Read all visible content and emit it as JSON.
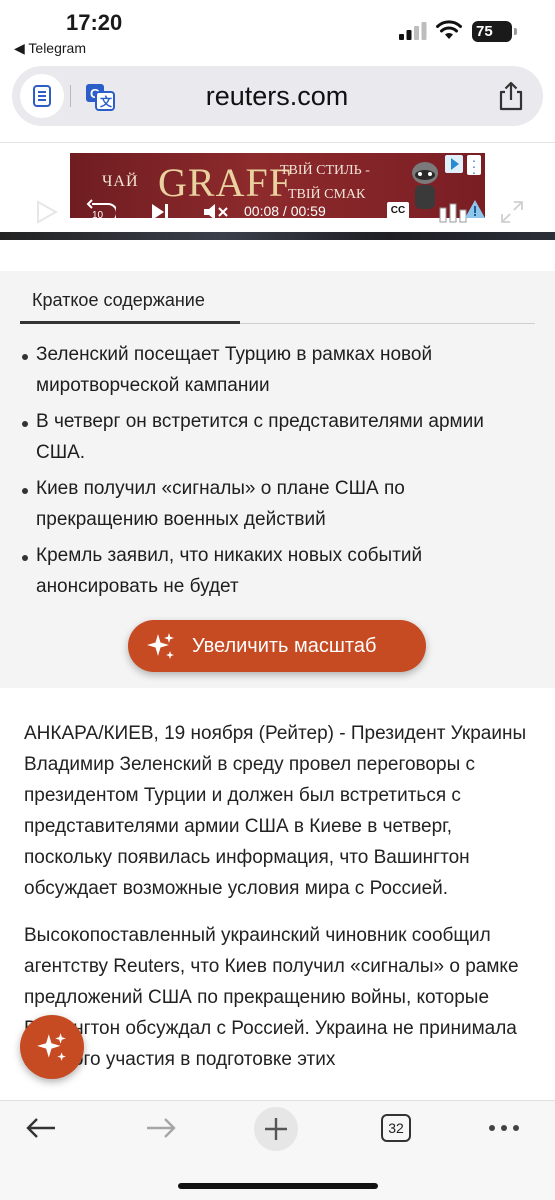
{
  "status": {
    "time": "17:20",
    "back_app": "◀ Telegram",
    "battery": "75"
  },
  "browser": {
    "domain": "reuters.com",
    "reader_icon": "reader-icon",
    "translate_icon": "translate-icon",
    "share_icon": "share-icon"
  },
  "ad": {
    "left_word": "ЧАЙ",
    "brand": "GRAFF",
    "slogan_line1": "ТВІЙ СТИЛЬ -",
    "slogan_line2": "ТВІЙ СМАК",
    "rewind_seconds": "10",
    "video_time": "00:08 / 00:59",
    "cc_label": "CC"
  },
  "summary": {
    "tab_label": "Краткое содержание",
    "bullets": [
      "Зеленский посещает Турцию в рамках новой миротворческой кампании",
      "В четверг он встретится с представителями армии США.",
      "Киев получил «сигналы» о плане США по прекращению военных действий",
      "Кремль заявил, что никаких новых событий анонсировать не будет"
    ],
    "zoom_button": "Увеличить масштаб"
  },
  "article": {
    "paragraphs": [
      "АНКАРА/КИЕВ, 19 ноября (Рейтер) - Президент Украины Владимир Зеленский в среду провел переговоры с президентом Турции и должен был встретиться с представителями армии США в Киеве в четверг, поскольку появилась информация, что Вашингтон обсуждает возможные условия мира с Россией.",
      "Высокопоставленный украинский чиновник сообщил агентству Reuters, что Киев получил «сигналы» о рамке предложений США по прекращению войны, которые Вашингтон обсуждал с Россией. Украина не принимала никакого участия в подготовке этих"
    ]
  },
  "toolbar": {
    "tab_count": "32"
  },
  "colors": {
    "accent": "#c64a22",
    "summary_bg": "#f4f4f4",
    "url_bar_bg": "#e9e9ee"
  }
}
